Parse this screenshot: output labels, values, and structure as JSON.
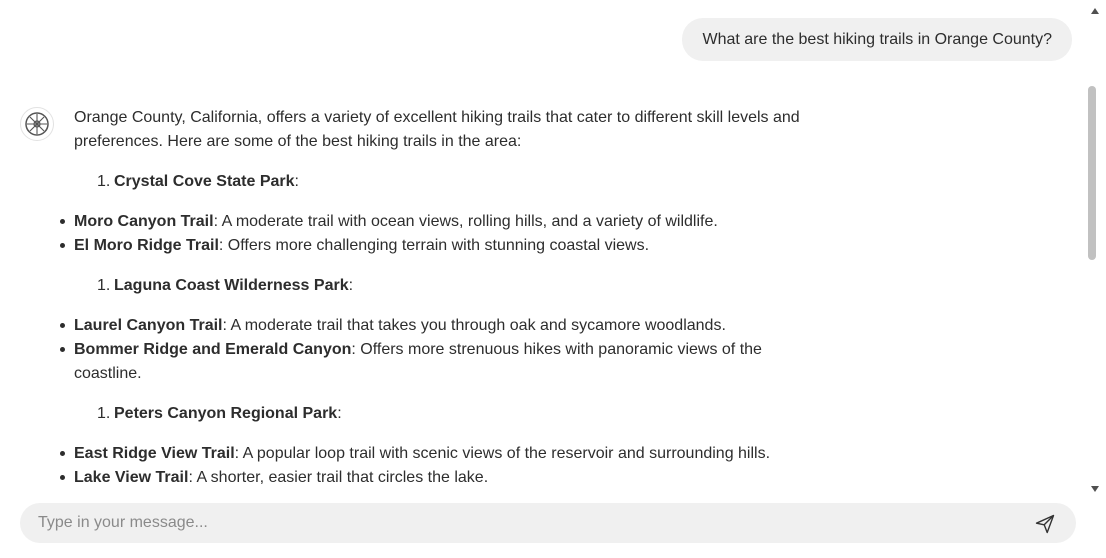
{
  "user_message": "What are the best hiking trails in Orange County?",
  "assistant": {
    "avatar_icon": "assistant-logo-icon",
    "intro": "Orange County, California, offers a variety of excellent hiking trails that cater to different skill levels and preferences. Here are some of the best hiking trails in the area:",
    "sections": [
      {
        "number": "1.",
        "park": "Crystal Cove State Park",
        "suffix": ":",
        "trails": [
          {
            "name": "Moro Canyon Trail",
            "desc": ": A moderate trail with ocean views, rolling hills, and a variety of wildlife."
          },
          {
            "name": "El Moro Ridge Trail",
            "desc": ": Offers more challenging terrain with stunning coastal views."
          }
        ]
      },
      {
        "number": "1.",
        "park": "Laguna Coast Wilderness Park",
        "suffix": ":",
        "trails": [
          {
            "name": "Laurel Canyon Trail",
            "desc": ": A moderate trail that takes you through oak and sycamore woodlands."
          },
          {
            "name": "Bommer Ridge and Emerald Canyon",
            "desc": ": Offers more strenuous hikes with panoramic views of the coastline."
          }
        ]
      },
      {
        "number": "1.",
        "park": "Peters Canyon Regional Park",
        "suffix": ":",
        "trails": [
          {
            "name": "East Ridge View Trail",
            "desc": ": A popular loop trail with scenic views of the reservoir and surrounding hills."
          },
          {
            "name": "Lake View Trail",
            "desc": ": A shorter, easier trail that circles the lake."
          }
        ]
      }
    ]
  },
  "input": {
    "placeholder": "Type in your message...",
    "value": ""
  },
  "send_icon": "send-icon"
}
